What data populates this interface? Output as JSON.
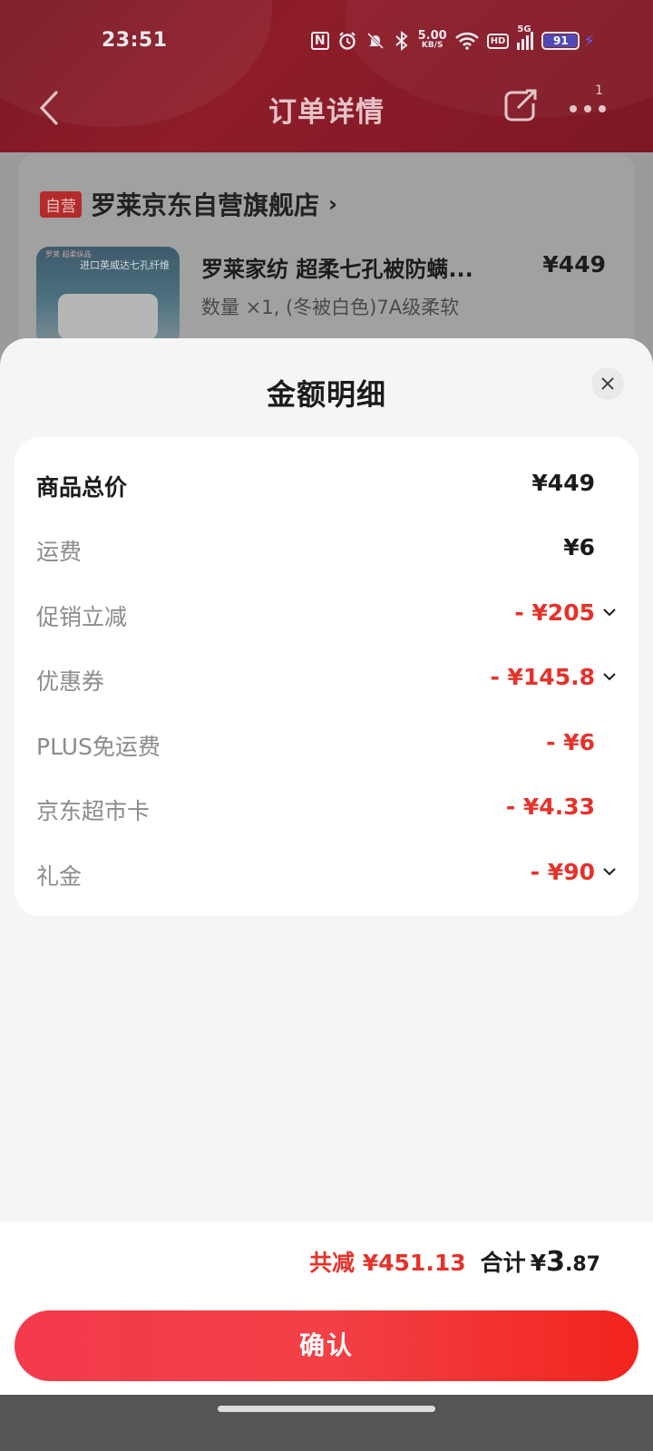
{
  "status_bar": {
    "time": "23:51",
    "nfc_icon": "N",
    "speed_value": "5.00",
    "speed_unit": "KB/S",
    "hd_label": "HD",
    "network_label": "5G",
    "battery_level": "91"
  },
  "navbar": {
    "title": "订单详情",
    "badge_count": "1"
  },
  "order": {
    "self_tag": "自营",
    "shop_name": "罗莱京东自营旗舰店",
    "product_image_text": "进口英威达七孔纤维",
    "product_image_brand": "罗莱 超柔纵品",
    "product_name": "罗莱家纺 超柔七孔被防螨...",
    "product_price": "¥449",
    "product_spec": "数量 ×1, (冬被白色)7A级柔软"
  },
  "sheet": {
    "title": "金额明细",
    "rows": [
      {
        "label": "商品总价",
        "amount": "¥449"
      },
      {
        "label": "运费",
        "amount": "¥6"
      },
      {
        "label": "促销立减",
        "amount": "- ¥205"
      },
      {
        "label": "优惠券",
        "amount": "- ¥145.8"
      },
      {
        "label": "PLUS免运费",
        "amount": "- ¥6"
      },
      {
        "label": "京东超市卡",
        "amount": "- ¥4.33"
      },
      {
        "label": "礼金",
        "amount": "- ¥90"
      }
    ]
  },
  "summary": {
    "saved": "共减 ¥451.13",
    "total_label": "合计",
    "total_currency": "¥",
    "total_int": "3",
    "total_dec": ".87"
  },
  "confirm_label": "确认",
  "colors": {
    "accent_red": "#e5322a",
    "header_red": "#8e1d29"
  }
}
